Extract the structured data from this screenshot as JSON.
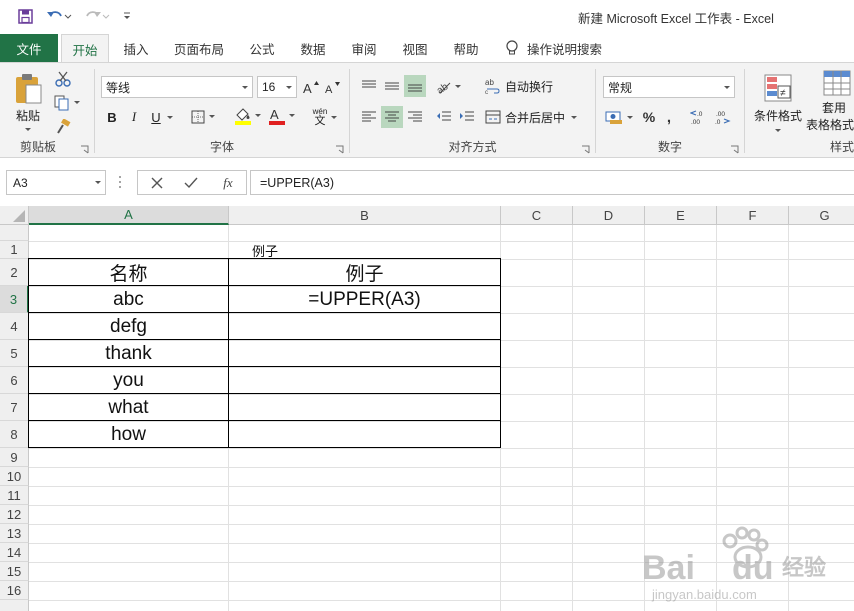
{
  "window": {
    "title": "新建 Microsoft Excel 工作表  -  Excel"
  },
  "tabs": [
    {
      "label": "文件"
    },
    {
      "label": "开始"
    },
    {
      "label": "插入"
    },
    {
      "label": "页面布局"
    },
    {
      "label": "公式"
    },
    {
      "label": "数据"
    },
    {
      "label": "审阅"
    },
    {
      "label": "视图"
    },
    {
      "label": "帮助"
    }
  ],
  "tell_me": "操作说明搜索",
  "ribbon": {
    "clipboard": {
      "label": "剪贴板",
      "paste": "粘贴"
    },
    "font": {
      "label": "字体",
      "name": "等线",
      "size": "16",
      "bold": "B",
      "italic": "I",
      "underline": "U",
      "font_color_glyph": "A",
      "phonetic_top": "wén",
      "phonetic_bottom": "文"
    },
    "alignment": {
      "label": "对齐方式",
      "wrap_text": "自动换行",
      "merge_center": "合并后居中"
    },
    "number": {
      "label": "数字",
      "format": "常规",
      "percent": "%",
      "comma": ","
    },
    "styles": {
      "label": "样式",
      "conditional": "条件格式",
      "table_line1": "套用",
      "table_line2": "表格格式"
    }
  },
  "formula_bar": {
    "name_box": "A3",
    "formula": "=UPPER(A3)",
    "fx": "fx"
  },
  "colors": {
    "accent": "#217346"
  },
  "sheet": {
    "columns": [
      "A",
      "B",
      "C",
      "D",
      "E",
      "F",
      "G"
    ],
    "rows": [
      "1",
      "2",
      "3",
      "4",
      "5",
      "6",
      "7",
      "8",
      "9",
      "10",
      "11",
      "12",
      "13",
      "14",
      "15",
      "16"
    ],
    "selected_cell": "A3",
    "cells": {
      "B1": "例子",
      "A2": "名称",
      "B2": "例子",
      "A3": "abc",
      "B3": "=UPPER(A3)",
      "A4": "defg",
      "A5": "thank",
      "A6": "you",
      "A7": "what",
      "A8": "how"
    }
  }
}
